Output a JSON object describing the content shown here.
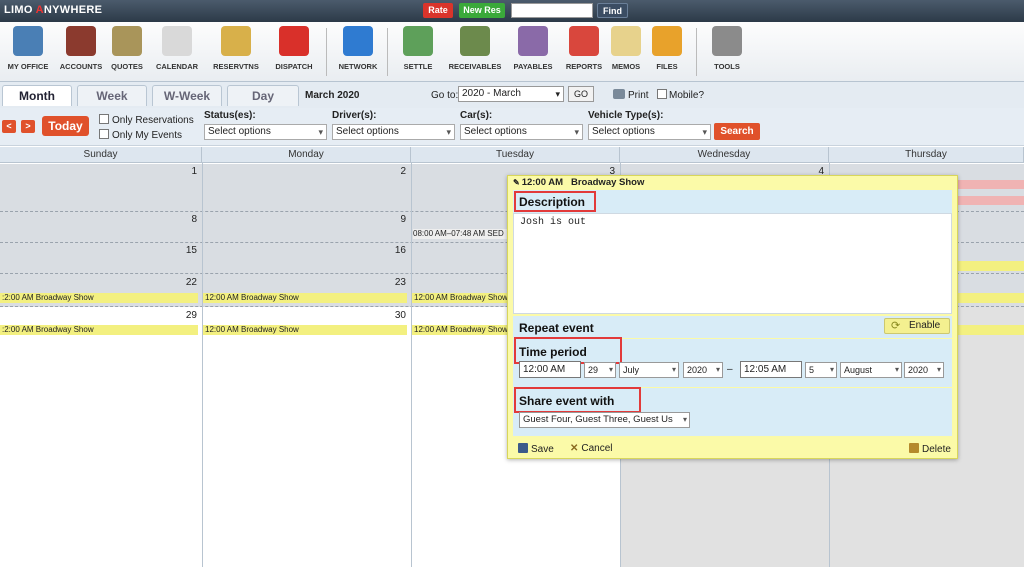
{
  "topbar": {
    "logo_a": "LIMO ",
    "logo_b": "A",
    "logo_c": "NYWHERE",
    "rate": "Rate",
    "new_res": "New Res",
    "find": "Find",
    "find_value": ""
  },
  "modules": [
    {
      "label": "MY OFFICE",
      "icon": "office-building-icon",
      "color": "#4a7fb5"
    },
    {
      "label": "ACCOUNTS",
      "icon": "address-book-icon",
      "color": "#8b3a2e"
    },
    {
      "label": "QUOTES",
      "icon": "money-bag-icon",
      "color": "#a9955a"
    },
    {
      "label": "CALENDAR",
      "icon": "calendar-icon",
      "color": "#d9d9d9"
    },
    {
      "label": "RESERVTNS",
      "icon": "notepad-pencil-icon",
      "color": "#d8b04a"
    },
    {
      "label": "DISPATCH",
      "icon": "red-car-icon",
      "color": "#d9302a"
    },
    {
      "label": "NETWORK",
      "icon": "globe-icon",
      "color": "#2f7bd1"
    },
    {
      "label": "SETTLE",
      "icon": "cash-icon",
      "color": "#5ea05a"
    },
    {
      "label": "RECEIVABLES",
      "icon": "inbox-icon",
      "color": "#6c8a4c"
    },
    {
      "label": "PAYABLES",
      "icon": "outbox-icon",
      "color": "#8a6aa8"
    },
    {
      "label": "REPORTS",
      "icon": "pie-chart-icon",
      "color": "#d9473d"
    },
    {
      "label": "MEMOS",
      "icon": "sticky-note-icon",
      "color": "#e7d28c"
    },
    {
      "label": "FILES",
      "icon": "folder-icon",
      "color": "#e8a22b"
    },
    {
      "label": "TOOLS",
      "icon": "tools-icon",
      "color": "#8b8b8b"
    }
  ],
  "views": {
    "month": "Month",
    "week": "Week",
    "wweek": "W-Week",
    "day": "Day"
  },
  "month_title": "March 2020",
  "goto": {
    "label": "Go to:",
    "value": "2020 - March",
    "go": "GO"
  },
  "print": "Print",
  "mobile": "Mobile?",
  "filters": {
    "prev": "<",
    "next": ">",
    "today": "Today",
    "only_res": "Only Reservations",
    "only_events": "Only My Events",
    "status_label": "Status(es):",
    "driver_label": "Driver(s):",
    "car_label": "Car(s):",
    "vtype_label": "Vehicle Type(s):",
    "placeholder": "Select options",
    "search": "Search"
  },
  "calendar": {
    "days": [
      "Sunday",
      "Monday",
      "Tuesday",
      "Wednesday",
      "Thursday"
    ],
    "dates": {
      "d1": "1",
      "d2": "2",
      "d3": "3",
      "d4": "4",
      "d8": "8",
      "d9": "9",
      "d15": "15",
      "d16": "16",
      "d22": "22",
      "d23": "23",
      "d29": "29",
      "d30": "30"
    },
    "event_short": "12:00 AM Broadway Show",
    "event_cut": ":2:00 AM Broadway Show",
    "res_text": "08:00 AM–07:48 AM SED"
  },
  "popup": {
    "header_time": "12:00 AM",
    "header_title": "Broadway Show",
    "description_label": "Description",
    "description_value": "Josh is out",
    "repeat_label": "Repeat event",
    "enable": "Enable",
    "time_label": "Time period",
    "start_time": "12:00 AM",
    "start_day": "29",
    "start_month": "July",
    "start_year": "2020",
    "dash": "–",
    "end_time": "12:05 AM",
    "end_day": "5",
    "end_month": "August",
    "end_year": "2020",
    "share_label": "Share event with",
    "share_value": "Guest Four, Guest Three, Guest Us",
    "save": "Save",
    "cancel": "Cancel",
    "delete": "Delete"
  }
}
